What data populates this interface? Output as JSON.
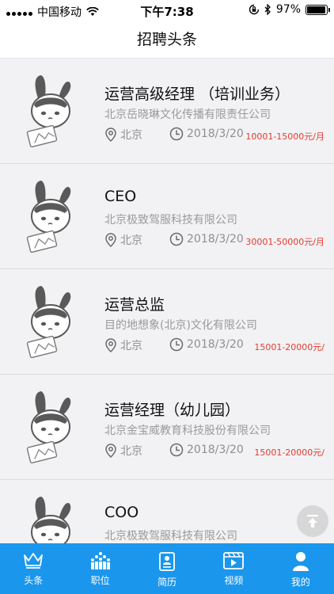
{
  "status_bar": {
    "carrier": "中国移动",
    "time": "下午7:38",
    "battery_percent": "97%",
    "battery_level": 0.97
  },
  "header": {
    "title": "招聘头条"
  },
  "jobs": [
    {
      "title": "运营高级经理 （培训业务）",
      "company": "北京岳晓琳文化传播有限责任公司",
      "location": "北京",
      "date": "2018/3/20",
      "salary": "10001-15000元/月"
    },
    {
      "title": "CEO",
      "company": "北京极致驾服科技有限公司",
      "location": "北京",
      "date": "2018/3/20",
      "salary": "30001-50000元/月"
    },
    {
      "title": "运营总监",
      "company": "目的地想象(北京)文化有限公司",
      "location": "北京",
      "date": "2018/3/20",
      "salary": "15001-20000元/"
    },
    {
      "title": "运营经理（幼儿园）",
      "company": "北京金宝威教育科技股份有限公司",
      "location": "北京",
      "date": "2018/3/20",
      "salary": "15001-20000元/"
    },
    {
      "title": "COO",
      "company": "北京极致驾服科技有限公司",
      "location": "",
      "date": "",
      "salary": ""
    }
  ],
  "tabbar": {
    "items": [
      {
        "label": "头条",
        "icon": "crown-icon"
      },
      {
        "label": "职位",
        "icon": "crowd-icon"
      },
      {
        "label": "简历",
        "icon": "resume-icon"
      },
      {
        "label": "视频",
        "icon": "video-icon"
      },
      {
        "label": "我的",
        "icon": "user-icon"
      }
    ]
  },
  "colors": {
    "tabbar_bg": "#1a96ec",
    "salary": "#e43a2c",
    "page_bg": "#f2f2f4"
  }
}
